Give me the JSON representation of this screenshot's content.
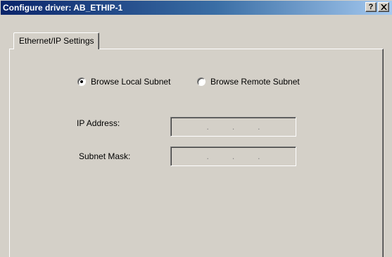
{
  "window": {
    "title": "Configure driver: AB_ETHIP-1",
    "help_button": "?",
    "close_button": "✕"
  },
  "tabs": [
    {
      "label": "Ethernet/IP Settings",
      "selected": true
    }
  ],
  "browse_mode": {
    "options": [
      {
        "label": "Browse Local Subnet",
        "selected": true
      },
      {
        "label": "Browse Remote Subnet",
        "selected": false
      }
    ]
  },
  "fields": {
    "ip_address": {
      "label": "IP Address:",
      "value": "",
      "separator": "."
    },
    "subnet_mask": {
      "label": "Subnet Mask:",
      "value": "",
      "separator": "."
    }
  },
  "colors": {
    "dialog_face": "#d4d0c8",
    "title_gradient_start": "#0a246a",
    "title_gradient_end": "#a6caf0",
    "title_text": "#ffffff"
  }
}
